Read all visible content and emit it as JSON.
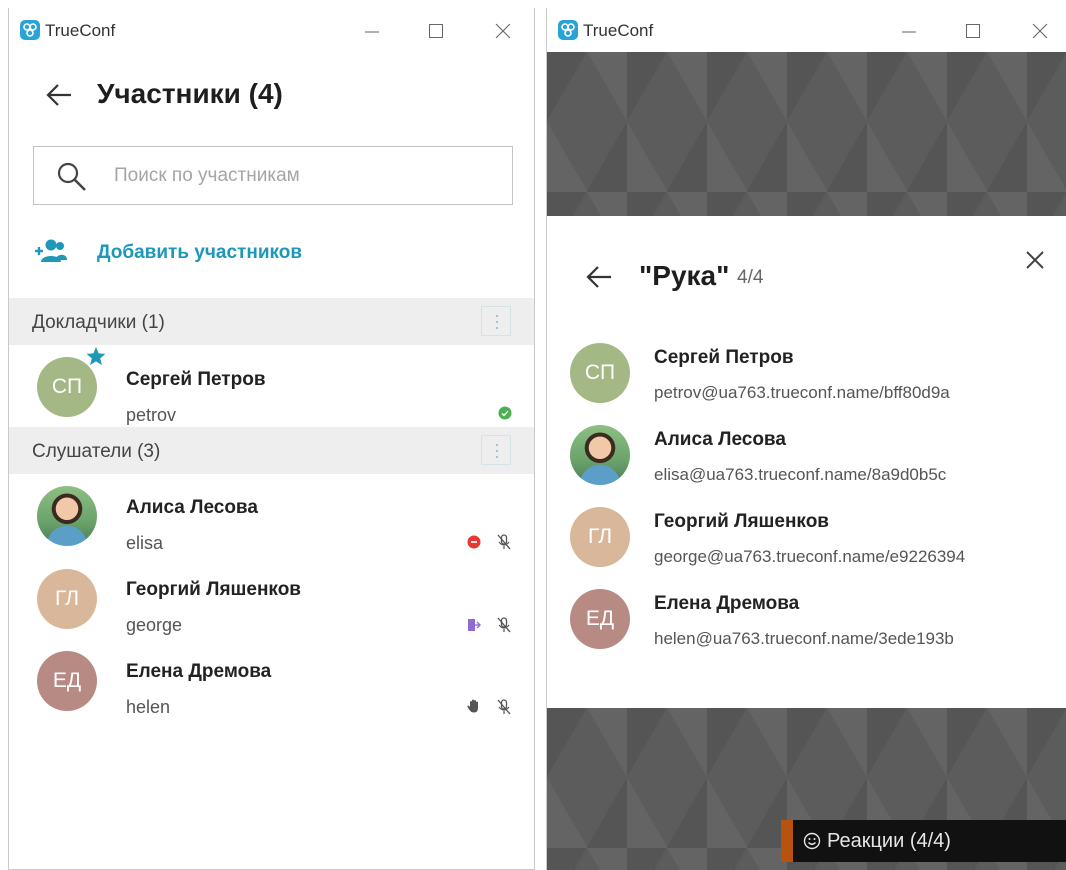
{
  "left_window": {
    "app_title": "TrueConf",
    "page_title": "Участники (4)",
    "search": {
      "placeholder": "Поиск по участникам",
      "value": ""
    },
    "add_participants_label": "Добавить участников",
    "sections": [
      {
        "label": "Докладчики (1)"
      },
      {
        "label": "Слушатели (3)"
      }
    ],
    "participants": [
      {
        "initials": "СП",
        "name": "Сергей Петров",
        "login": "petrov",
        "avatar_color": "#a3b884",
        "role": "speaker",
        "is_moderator": true,
        "status_icon": "online-status-icon",
        "mic_muted": false
      },
      {
        "initials": "",
        "name": "Алиса Лесова",
        "login": "elisa",
        "avatar_color": "photo",
        "role": "listener",
        "status_icon": "busy-status-icon",
        "mic_muted": true
      },
      {
        "initials": "ГЛ",
        "name": "Георгий Ляшенков",
        "login": "george",
        "avatar_color": "#d9b79b",
        "role": "listener",
        "status_icon": "exit-door-icon",
        "mic_muted": true
      },
      {
        "initials": "ЕД",
        "name": "Елена Дремова",
        "login": "helen",
        "avatar_color": "#b88a84",
        "role": "listener",
        "status_icon": "hand-raised-icon",
        "mic_muted": true
      }
    ]
  },
  "right_window": {
    "app_title": "TrueConf",
    "panel_title": "\"Рука\"",
    "panel_count": "4/4",
    "participants": [
      {
        "initials": "СП",
        "name": "Сергей Петров",
        "email": "petrov@ua763.trueconf.name/bff80d9a",
        "avatar_color": "#a3b884"
      },
      {
        "initials": "",
        "name": "Алиса Лесова",
        "email": "elisa@ua763.trueconf.name/8a9d0b5c",
        "avatar_color": "photo"
      },
      {
        "initials": "ГЛ",
        "name": "Георгий Ляшенков",
        "email": "george@ua763.trueconf.name/e9226394",
        "avatar_color": "#d9b79b"
      },
      {
        "initials": "ЕД",
        "name": "Елена Дремова",
        "email": "helen@ua763.trueconf.name/3ede193b",
        "avatar_color": "#b88a84"
      }
    ],
    "reactions_label": "Реакции (4/4)"
  },
  "colors": {
    "accent": "#1d98b8",
    "online": "#4caf50",
    "busy": "#e53935",
    "reactions_bar": "#111111",
    "reactions_accent": "#b8520f"
  }
}
